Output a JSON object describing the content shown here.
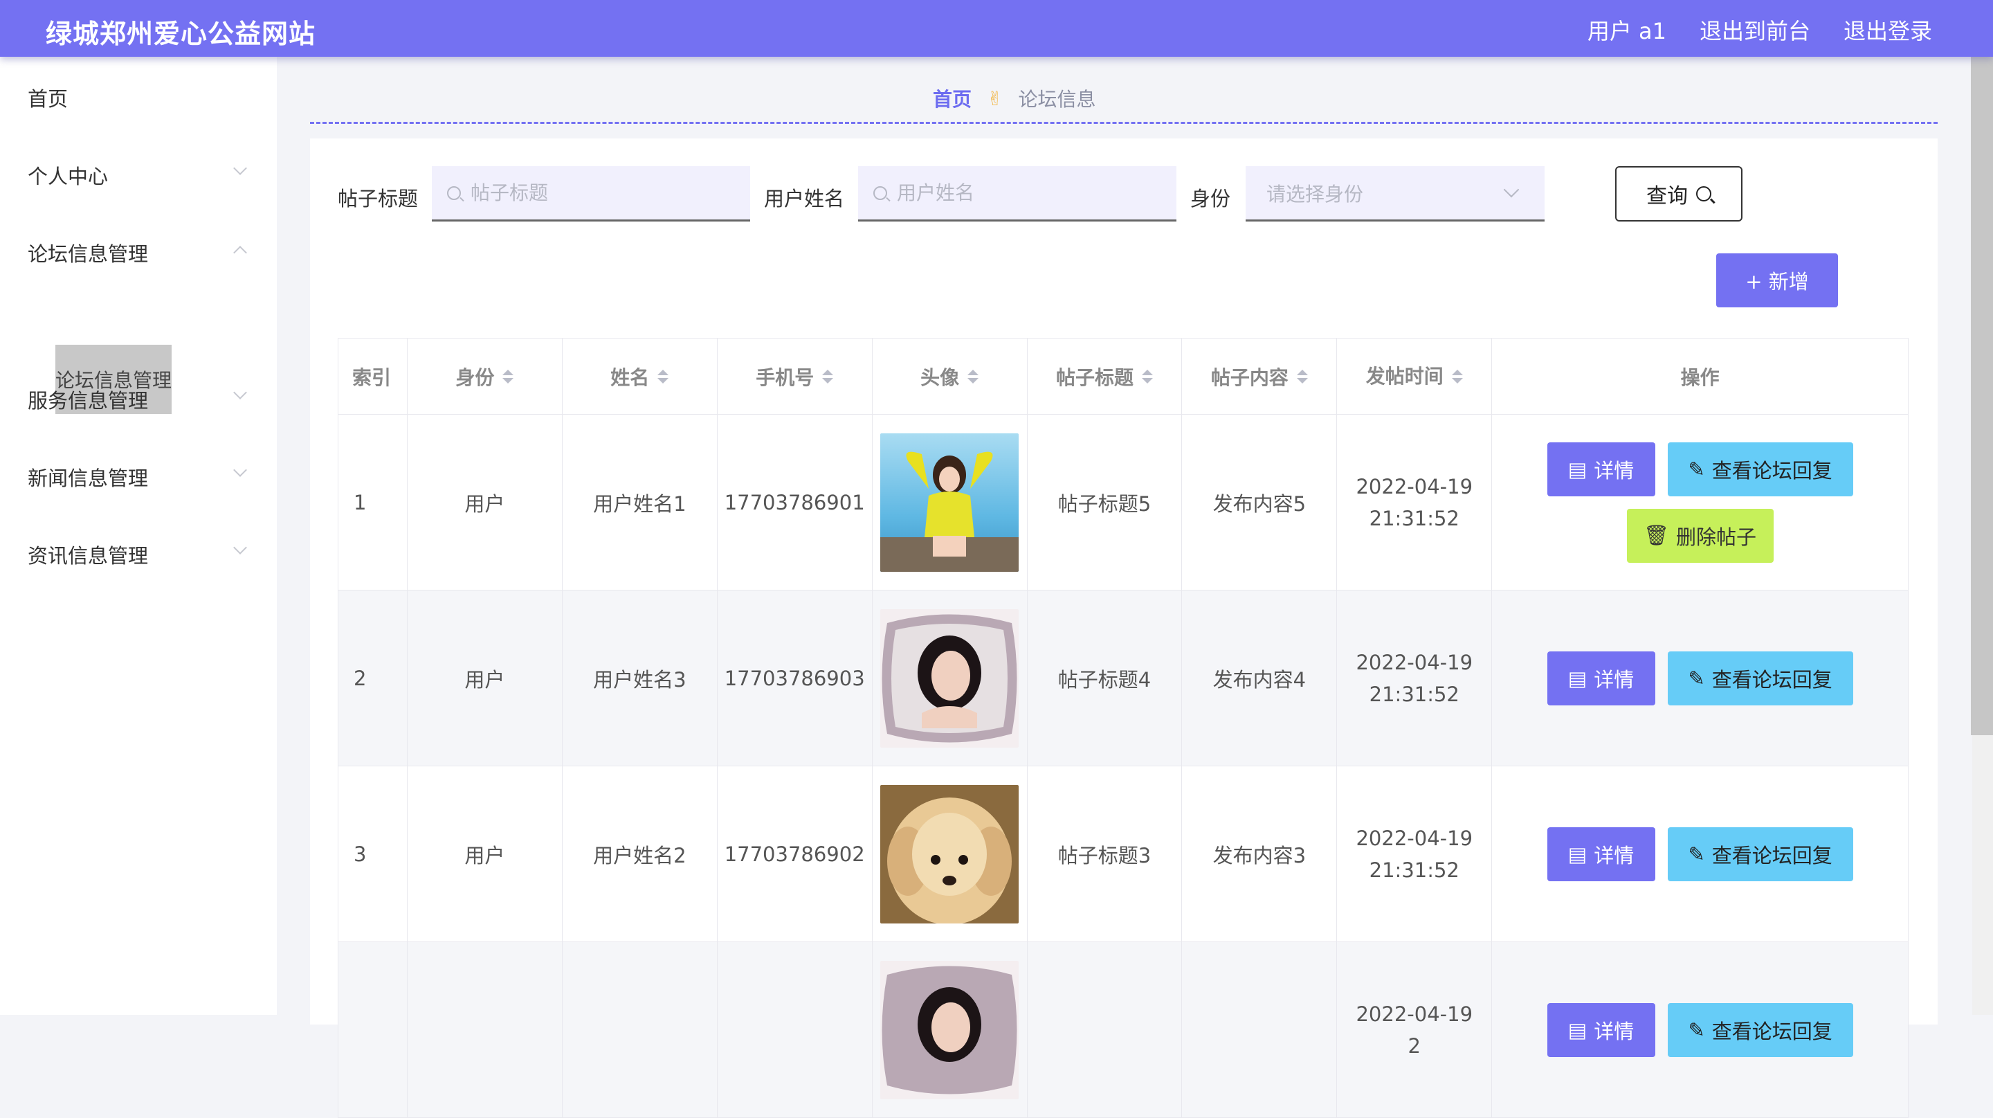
{
  "header": {
    "title": "绿城郑州爱心公益网站",
    "links": [
      "用户 a1",
      "退出到前台",
      "退出登录"
    ]
  },
  "sidebar": {
    "items": [
      {
        "label": "首页"
      },
      {
        "label": "个人中心"
      },
      {
        "label": "论坛信息管理"
      },
      {
        "label": "服务信息管理"
      },
      {
        "label": "新闻信息管理"
      },
      {
        "label": "资讯信息管理"
      }
    ],
    "active_sub": "论坛信息管理"
  },
  "breadcrumb": {
    "home": "首页",
    "separator": "✌",
    "current": "论坛信息"
  },
  "search": {
    "title_label": "帖子标题",
    "title_placeholder": "帖子标题",
    "name_label": "用户姓名",
    "name_placeholder": "用户姓名",
    "role_label": "身份",
    "role_placeholder": "请选择身份",
    "query_label": "查询"
  },
  "add_label": "+ 新增",
  "table": {
    "headers": [
      "索引",
      "身份",
      "姓名",
      "手机号",
      "头像",
      "帖子标题",
      "帖子内容",
      "发帖时间",
      "操作"
    ],
    "rows": [
      {
        "idx": "1",
        "role": "用户",
        "name": "用户姓名1",
        "phone": "17703786901",
        "title": "帖子标题5",
        "content": "发布内容5",
        "time": "2022-04-19 21:31:52"
      },
      {
        "idx": "2",
        "role": "用户",
        "name": "用户姓名3",
        "phone": "17703786903",
        "title": "帖子标题4",
        "content": "发布内容4",
        "time": "2022-04-19 21:31:52"
      },
      {
        "idx": "3",
        "role": "用户",
        "name": "用户姓名2",
        "phone": "17703786902",
        "title": "帖子标题3",
        "content": "发布内容3",
        "time": "2022-04-19 21:31:52"
      },
      {
        "idx": "",
        "role": "",
        "name": "",
        "phone": "",
        "title": "",
        "content": "",
        "time": "2022-04-19 2"
      }
    ],
    "btn_detail": "详情",
    "btn_reply": "查看论坛回复",
    "btn_delete": "删除帖子"
  },
  "colors": {
    "primary": "#7471f2",
    "reply": "#66ccf7",
    "delete": "#c6f05a"
  }
}
